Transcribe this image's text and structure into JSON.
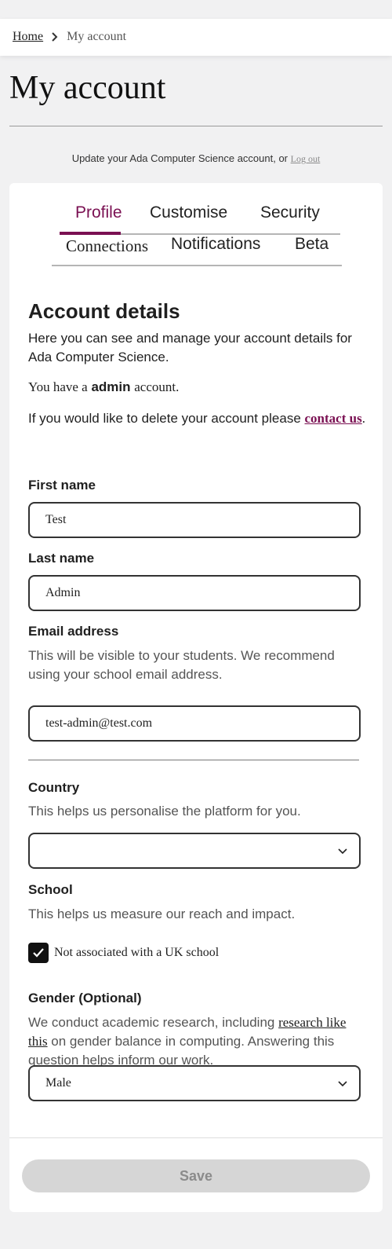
{
  "breadcrumb": {
    "home": "Home",
    "current": "My account"
  },
  "page": {
    "title": "My account",
    "subtitle_text": "Update your Ada Computer Science account, or",
    "logout_label": "Log out"
  },
  "tabs": {
    "row1": [
      "Profile",
      "Customise",
      "Security"
    ],
    "row2": [
      "Connections",
      "Notifications",
      "Beta"
    ],
    "active": "Profile"
  },
  "account_details": {
    "heading": "Account details",
    "intro": "Here you can see and manage your account details for Ada Computer Science.",
    "role_prefix": "You have a",
    "role": "admin",
    "role_suffix": "account.",
    "delete_text": "If you would like to delete your account please",
    "delete_link": "contact us",
    "delete_end": "."
  },
  "form": {
    "first_name": {
      "label": "First name",
      "value": "Test"
    },
    "last_name": {
      "label": "Last name",
      "value": "Admin"
    },
    "email": {
      "label": "Email address",
      "help": "This will be visible to your students. We recommend using your school email address.",
      "value": "test-admin@test.com"
    },
    "country": {
      "label": "Country",
      "help": "This helps us personalise the platform for you.",
      "value": ""
    },
    "school": {
      "label": "School",
      "help": "This helps us measure our reach and impact.",
      "checkbox_label": "Not associated with a UK school",
      "checked": true
    },
    "gender": {
      "label": "Gender (Optional)",
      "help_prefix": "We conduct academic research, including",
      "help_link": "research like this",
      "help_suffix": "on gender balance in computing. Answering this question helps inform our work.",
      "value": "Male"
    },
    "save_label": "Save"
  },
  "colors": {
    "accent": "#7a1052",
    "save_disabled_bg": "#d6d6d6"
  }
}
